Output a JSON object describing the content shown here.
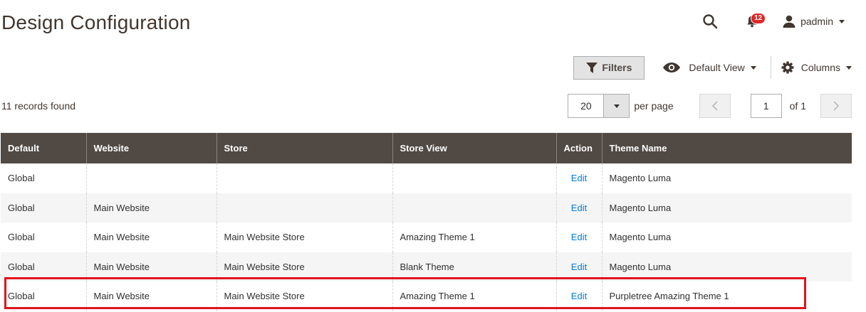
{
  "page": {
    "title": "Design Configuration"
  },
  "header": {
    "notifications_count": "12",
    "user_name": "padmin"
  },
  "toolbar": {
    "filters_label": "Filters",
    "view_label": "Default View",
    "columns_label": "Columns"
  },
  "records": {
    "found_text": "11 records found"
  },
  "pager": {
    "per_page_value": "20",
    "per_page_label": "per page",
    "current_page": "1",
    "of_label": "of 1"
  },
  "grid": {
    "columns": [
      "Default",
      "Website",
      "Store",
      "Store View",
      "Action",
      "Theme Name"
    ],
    "rows": [
      {
        "default": "Global",
        "website": "",
        "store": "",
        "store_view": "",
        "action": "Edit",
        "theme": "Magento Luma"
      },
      {
        "default": "Global",
        "website": "Main Website",
        "store": "",
        "store_view": "",
        "action": "Edit",
        "theme": "Magento Luma"
      },
      {
        "default": "Global",
        "website": "Main Website",
        "store": "Main Website Store",
        "store_view": "Amazing Theme 1",
        "action": "Edit",
        "theme": "Magento Luma"
      },
      {
        "default": "Global",
        "website": "Main Website",
        "store": "Main Website Store",
        "store_view": "Blank Theme",
        "action": "Edit",
        "theme": "Magento Luma"
      },
      {
        "default": "Global",
        "website": "Main Website",
        "store": "Main Website Store",
        "store_view": "Amazing Theme 1",
        "action": "Edit",
        "theme": "Purpletree Amazing Theme 1"
      }
    ]
  },
  "colors": {
    "header_bg": "#514943",
    "link": "#007bdb",
    "highlight": "#e0141e",
    "badge": "#e22626"
  }
}
